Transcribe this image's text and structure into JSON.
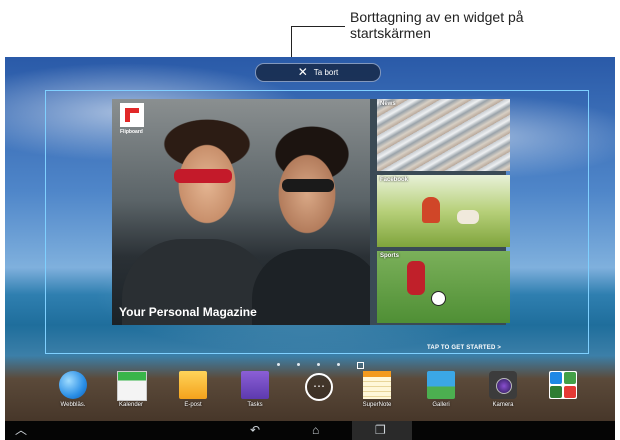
{
  "callout": {
    "text": "Borttagning av en widget på\nstartskärmen"
  },
  "remove_bar": {
    "icon": "close-icon",
    "label": "Ta bort"
  },
  "widget": {
    "brand": "Flipboard",
    "title": "Your Personal Magazine",
    "tiles": [
      {
        "label": "News"
      },
      {
        "label": "Facebook"
      },
      {
        "label": "Sports"
      }
    ],
    "cta": "TAP TO GET STARTED >"
  },
  "page_indicator": {
    "count": 5,
    "current_index": 4
  },
  "dock": {
    "apps": [
      {
        "label": "Webbläs.",
        "icon": "browser-globe-icon"
      },
      {
        "label": "Kalender",
        "icon": "calendar-icon"
      },
      {
        "label": "E-post",
        "icon": "email-icon"
      },
      {
        "label": "Tasks",
        "icon": "tasks-checkbox-icon"
      },
      {
        "label": "",
        "icon": "all-apps-icon"
      },
      {
        "label": "SuperNote",
        "icon": "supernote-notebook-icon"
      },
      {
        "label": "Galleri",
        "icon": "gallery-icon"
      },
      {
        "label": "Kamera",
        "icon": "camera-icon"
      },
      {
        "label": "",
        "icon": "google-apps-folder-icon"
      }
    ]
  },
  "navbar": {
    "items": [
      "asus-menu-icon",
      "back-icon",
      "home-icon",
      "recent-apps-icon"
    ]
  }
}
